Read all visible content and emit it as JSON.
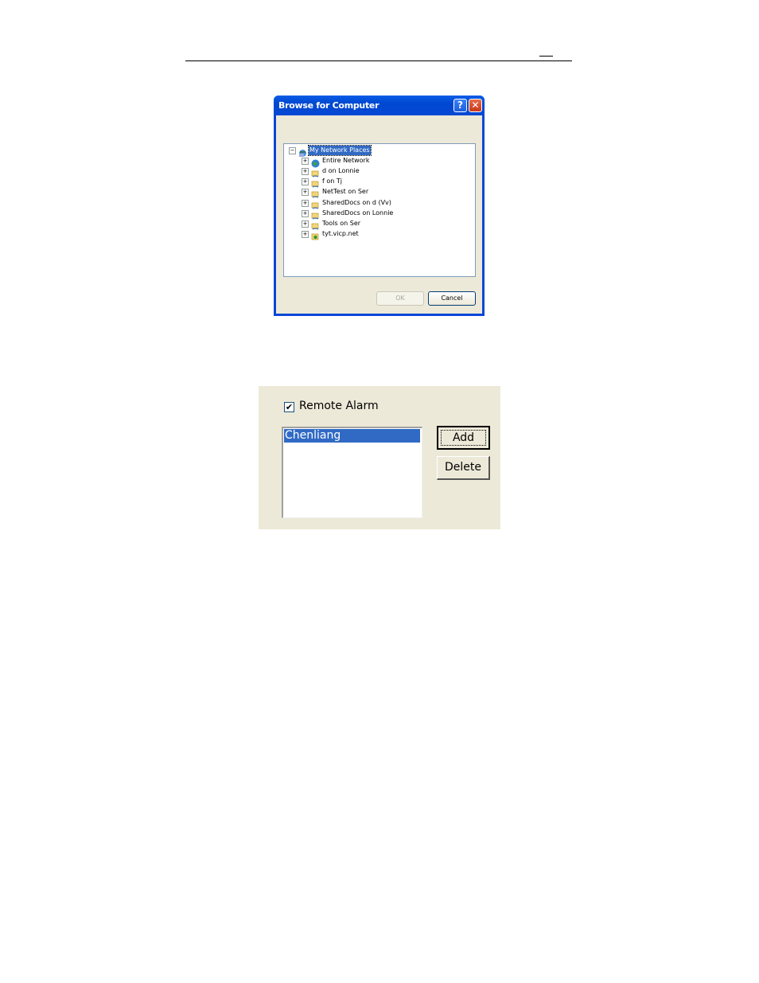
{
  "dialog": {
    "title": "Browse for Computer",
    "help_glyph": "?",
    "close_glyph": "✕",
    "tree": [
      {
        "label": "My Network Places",
        "expander": "−",
        "icon": "network-places-icon",
        "selected": true
      },
      {
        "label": "Entire Network",
        "expander": "+",
        "icon": "entire-network-icon"
      },
      {
        "label": "d on Lonnie",
        "expander": "+",
        "icon": "shared-folder-icon"
      },
      {
        "label": "f on Tj",
        "expander": "+",
        "icon": "shared-folder-icon"
      },
      {
        "label": "NetTest on Ser",
        "expander": "+",
        "icon": "shared-folder-icon"
      },
      {
        "label": "SharedDocs on d (Vv)",
        "expander": "+",
        "icon": "shared-folder-icon"
      },
      {
        "label": "SharedDocs on Lonnie",
        "expander": "+",
        "icon": "shared-folder-icon"
      },
      {
        "label": "Tools on Ser",
        "expander": "+",
        "icon": "shared-folder-icon"
      },
      {
        "label": "tyt.vicp.net",
        "expander": "+",
        "icon": "web-folder-icon"
      }
    ],
    "ok_label": "OK",
    "cancel_label": "Cancel"
  },
  "alarm_panel": {
    "checkbox_checked": true,
    "checkbox_mark": "✔",
    "checkbox_label": "Remote Alarm",
    "list_items": [
      "Chenliang"
    ],
    "add_label": "Add",
    "delete_label": "Delete"
  },
  "colors": {
    "title_bar": "#0a46d6",
    "selection": "#316ac5",
    "dialog_face": "#ece9d8"
  }
}
